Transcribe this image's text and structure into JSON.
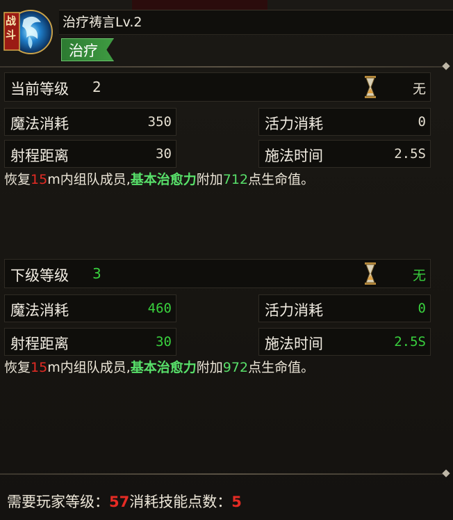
{
  "skill": {
    "icon_badge": "战斗",
    "name": "治疗祷言Lv.2",
    "tag": "治疗"
  },
  "current": {
    "level_label": "当前等级",
    "level_value": "2",
    "cooldown_value": "无",
    "mana_label": "魔法消耗",
    "mana_value": "350",
    "vigor_label": "活力消耗",
    "vigor_value": "0",
    "range_label": "射程距离",
    "range_value": "30",
    "cast_label": "施法时间",
    "cast_value": "2.5S",
    "desc": {
      "p1": "恢复",
      "range": "15",
      "p2": "m内组队成员,",
      "highlight": "基本治愈力",
      "p3": "附加",
      "amount": "712",
      "p4": "点生命值。"
    }
  },
  "next": {
    "level_label": "下级等级",
    "level_value": "3",
    "cooldown_value": "无",
    "mana_label": "魔法消耗",
    "mana_value": "460",
    "vigor_label": "活力消耗",
    "vigor_value": "0",
    "range_label": "射程距离",
    "range_value": "30",
    "cast_label": "施法时间",
    "cast_value": "2.5S",
    "desc": {
      "p1": "恢复",
      "range": "15",
      "p2": "m内组队成员,",
      "highlight": "基本治愈力",
      "p3": "附加",
      "amount": "972",
      "p4": "点生命值。"
    }
  },
  "footer": {
    "req_label": "需要玩家等级：",
    "req_value": "57",
    "cost_label": "消耗技能点数：",
    "cost_value": "5"
  },
  "colors": {
    "upgrade_green": "#39d13e",
    "accent_red": "#e52b24",
    "highlight_green": "#58e06a"
  }
}
